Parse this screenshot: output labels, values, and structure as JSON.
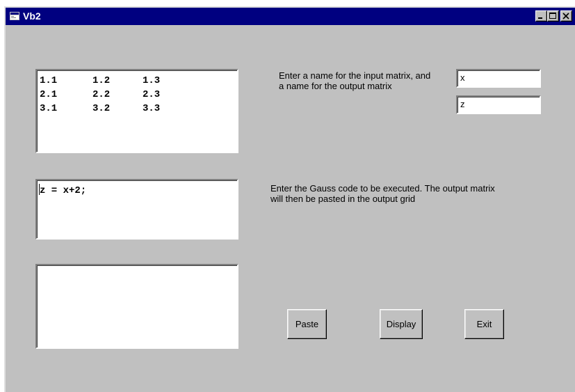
{
  "window": {
    "title": "Vb2",
    "title_bg": "#000080",
    "face_color": "#c0c0c0",
    "controls": [
      "minimize-icon",
      "maximize-icon",
      "close-icon"
    ]
  },
  "input_grid": {
    "rows": [
      [
        "1.1",
        "1.2",
        "1.3"
      ],
      [
        "2.1",
        "2.2",
        "2.3"
      ],
      [
        "3.1",
        "3.2",
        "3.3"
      ]
    ]
  },
  "names": {
    "instruction": "Enter a name for the input matrix, and a name for the output matrix",
    "input_name": "x",
    "output_name": "z"
  },
  "code": {
    "instruction": "Enter the Gauss code to be executed.  The output matrix will then be pasted in the output grid",
    "value": "z = x+2;"
  },
  "output_grid": {
    "rows": []
  },
  "buttons": {
    "paste": "Paste",
    "display": "Display",
    "exit": "Exit"
  }
}
